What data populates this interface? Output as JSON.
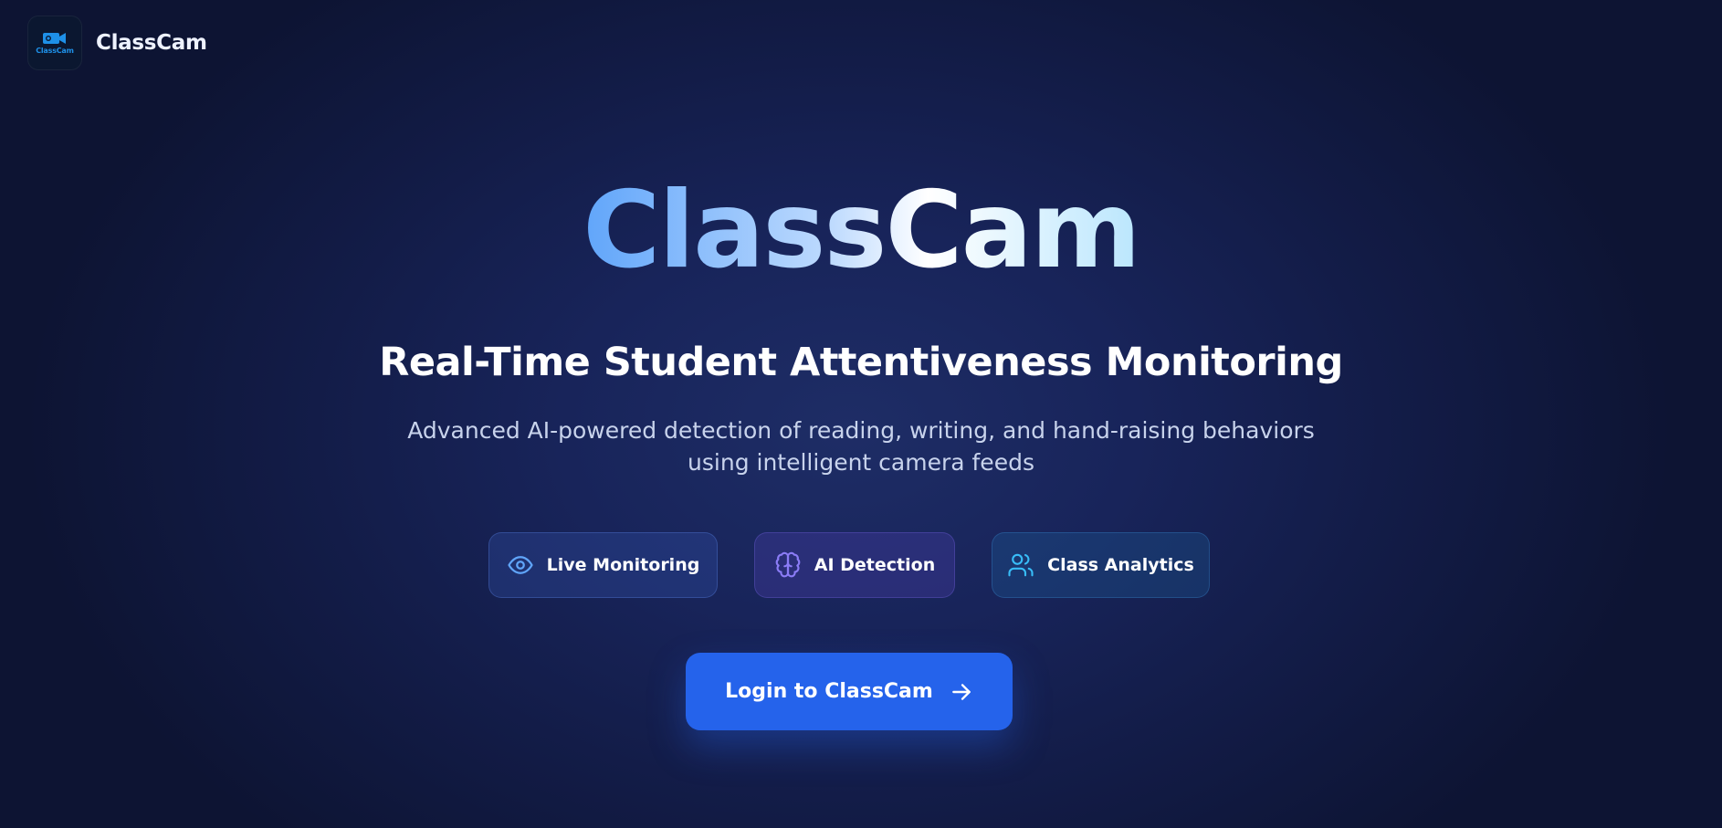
{
  "header": {
    "logo_text": "ClassCam",
    "brand_name": "ClassCam"
  },
  "hero": {
    "title": "ClassCam",
    "subtitle": "Real-Time Student Attentiveness Monitoring",
    "description": "Advanced AI-powered detection of reading, writing, and hand-raising behaviors using intelligent camera feeds"
  },
  "features": [
    {
      "label": "Live Monitoring",
      "icon": "eye-icon",
      "color": "#60a5fa"
    },
    {
      "label": "AI Detection",
      "icon": "brain-icon",
      "color": "#8b7cf6"
    },
    {
      "label": "Class Analytics",
      "icon": "users-icon",
      "color": "#38bdf8"
    }
  ],
  "cta": {
    "label": "Login to ClassCam",
    "icon": "arrow-right-icon",
    "color": "#2563eb"
  }
}
